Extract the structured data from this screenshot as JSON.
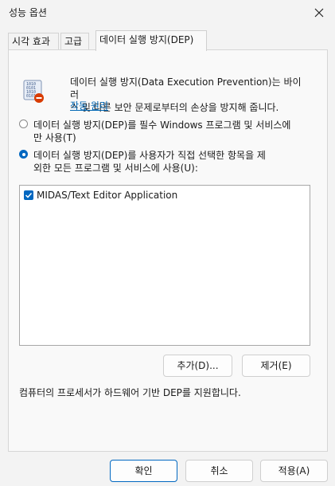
{
  "window": {
    "title": "성능 옵션"
  },
  "tabs": [
    {
      "label": "시각 효과"
    },
    {
      "label": "고급"
    },
    {
      "label": "데이터 실행 방지(DEP)"
    }
  ],
  "dep": {
    "description_line1": "데이터 실행 방지(Data Execution Prevention)는 바이러",
    "description_line2": "스 및 다른 보안 문제로부터의 손상을 방지해 줍니다.",
    "link": "작동 원리",
    "option1_line1": "데이터 실행 방지(DEP)를 필수 Windows 프로그램 및 서비스에",
    "option1_line2": "만 사용(T)",
    "option2_line1": "데이터 실행 방지(DEP)를 사용자가 직접 선택한 항목을 제",
    "option2_line2": "외한 모든 프로그램 및 서비스에 사용(U):",
    "list_items": [
      {
        "label": "MIDAS/Text Editor Application",
        "checked": true
      }
    ],
    "add_button": "추가(D)...",
    "remove_button": "제거(E)",
    "support_text": "컴퓨터의 프로세서가 하드웨어 기반 DEP를 지원합니다."
  },
  "footer": {
    "ok": "확인",
    "cancel": "취소",
    "apply": "적용(A)"
  },
  "colors": {
    "accent": "#0067c0",
    "link": "#0066b4"
  }
}
